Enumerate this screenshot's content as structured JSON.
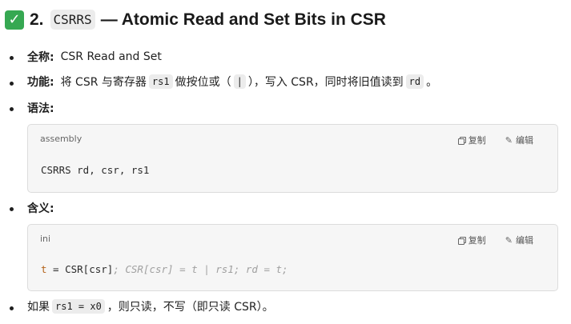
{
  "heading": {
    "number": "2.",
    "code": "CSRRS",
    "title": "— Atomic Read and Set Bits in CSR"
  },
  "bullets": {
    "fullname": {
      "label": "全称:",
      "text": "CSR Read and Set"
    },
    "function": {
      "label": "功能:",
      "part1": "将 CSR 与寄存器",
      "reg": "rs1",
      "part2": "做按位或（",
      "op": "|",
      "part3": "），写入 CSR，同时将旧值读到",
      "rd": "rd",
      "part4": "。"
    },
    "syntax": {
      "label": "语法:"
    },
    "meaning": {
      "label": "含义:"
    },
    "note": {
      "part1": "如果",
      "cond": "rs1 = x0",
      "part2": "，则只读，不写（即只读 CSR）。"
    }
  },
  "code_blocks": {
    "syntax": {
      "lang": "assembly",
      "copy_label": "复制",
      "edit_label": "编辑",
      "code": "CSRRS rd, csr, rs1"
    },
    "meaning": {
      "lang": "ini",
      "copy_label": "复制",
      "edit_label": "编辑",
      "code_var": "t",
      "code_main": " = CSR[csr]",
      "code_comment": "; CSR[csr] = t | rs1; rd = t;"
    }
  },
  "icons": {
    "heading_check": "check-mark-icon",
    "copy": "copy-icon",
    "edit": "pencil-icon"
  },
  "colors": {
    "check_icon": "#36a852",
    "code_block_bg": "#f6f6f6",
    "chip_bg": "#ececec",
    "code_var": "#b5651d",
    "code_comment": "#a0a0a0"
  }
}
